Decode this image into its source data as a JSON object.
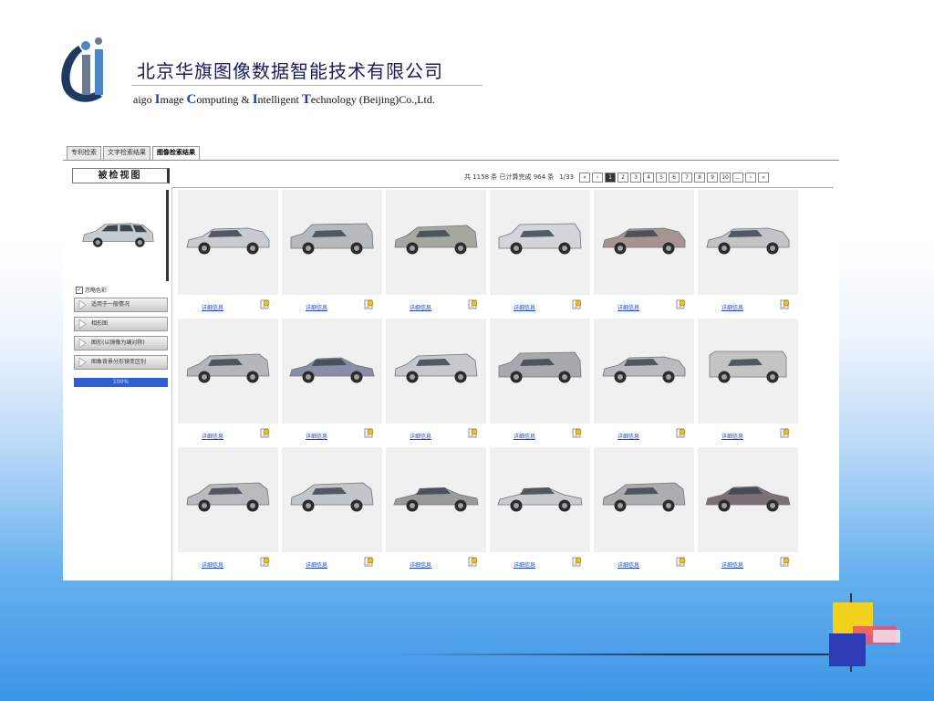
{
  "header": {
    "company_cn": "北京华旗图像数据智能技术有限公司",
    "company_en": {
      "prefix": "aigo ",
      "I1": "I",
      "p1": "mage ",
      "C": "C",
      "p2": "omputing & ",
      "I2": "I",
      "p3": "ntelligent ",
      "T": "T",
      "p4": "echnology (Beijing)Co.,Ltd."
    }
  },
  "tabs": [
    "专利检索",
    "文字检索结果",
    "图像检索结果"
  ],
  "active_tab": 2,
  "sidebar": {
    "title": "被检视图",
    "checkbox_label": "忽略色彩",
    "options": [
      "适用于一般情况",
      "相形图",
      "图形(以镜像为编对称)",
      "图象背景分形镜变区别"
    ],
    "progress_text": "100%"
  },
  "results_bar": {
    "summary": "共 1158 条  已计算完成  964 条",
    "page_indicator": "1/33",
    "pages": [
      "1",
      "2",
      "3",
      "4",
      "5",
      "6",
      "7",
      "8",
      "9",
      "10"
    ],
    "current_page": "1",
    "more": "...",
    "first": "«",
    "prev": "‹",
    "next": "›",
    "last": "»"
  },
  "gallery": {
    "detail_label": "详细信息",
    "items": [
      {
        "shape": "wagon",
        "color": "#c8cbd0"
      },
      {
        "shape": "suv",
        "color": "#b7babd"
      },
      {
        "shape": "mpv",
        "color": "#a7a7a2"
      },
      {
        "shape": "suv",
        "color": "#d2d5da"
      },
      {
        "shape": "wagon",
        "color": "#a59492"
      },
      {
        "shape": "wagon",
        "color": "#c2c4c8"
      },
      {
        "shape": "mpv",
        "color": "#b4b6b9"
      },
      {
        "shape": "sedan",
        "color": "#8a8ca8"
      },
      {
        "shape": "mpv",
        "color": "#c6c8cc"
      },
      {
        "shape": "suv",
        "color": "#a7a9ac"
      },
      {
        "shape": "wagon",
        "color": "#b9bbbf"
      },
      {
        "shape": "box",
        "color": "#c4c4c2"
      },
      {
        "shape": "mpv",
        "color": "#b8babd"
      },
      {
        "shape": "mpv",
        "color": "#c2c5ca"
      },
      {
        "shape": "coupe",
        "color": "#9a9a98"
      },
      {
        "shape": "coupe",
        "color": "#c9cbcf"
      },
      {
        "shape": "mpv",
        "color": "#acadae"
      },
      {
        "shape": "sedan",
        "color": "#7e6f77"
      }
    ]
  },
  "colors": {
    "tab_border": "#999999",
    "link": "#2244cc",
    "progress": "#2f5fd0",
    "logo_dark": "#1f3a60",
    "logo_blue": "#4b86c8"
  }
}
